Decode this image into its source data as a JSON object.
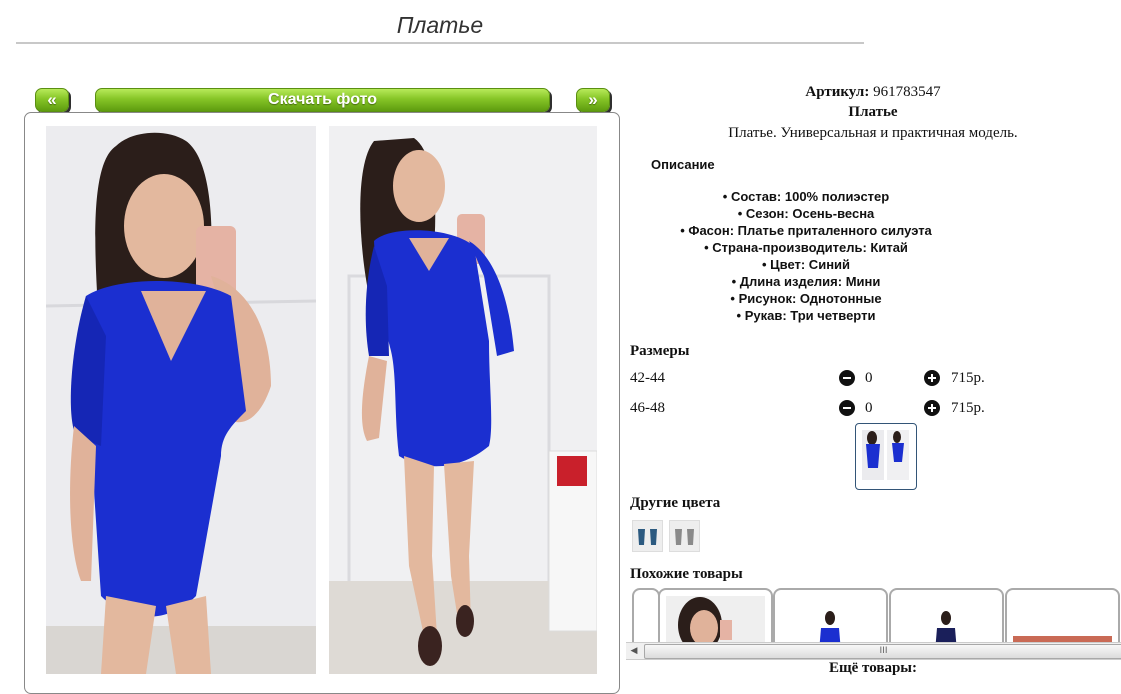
{
  "page": {
    "title": "Платье"
  },
  "nav": {
    "prev_label": "«",
    "download_label": "Скачать фото",
    "next_label": "»"
  },
  "product": {
    "article_label": "Артикул:",
    "article_value": "961783547",
    "name": "Платье",
    "short_description": "Платье. Универсальная и практичная модель."
  },
  "description": {
    "title": "Описание",
    "properties": [
      "Состав: 100% полиэстер",
      "Сезон: Осень-весна",
      "Фасон: Платье приталенного силуэта",
      "Страна-производитель: Китай",
      "Цвет: Синий",
      "Длина изделия: Мини",
      "Рисунок: Однотонные",
      "Рукав: Три четверти"
    ]
  },
  "sizes": {
    "title": "Размеры",
    "rows": [
      {
        "label": "42-44",
        "qty": "0",
        "price": "715р."
      },
      {
        "label": "46-48",
        "qty": "0",
        "price": "715р."
      }
    ]
  },
  "other_colors": {
    "title": "Другие цвета"
  },
  "similar": {
    "title": "Похожие товары"
  },
  "scrollbar": {
    "left_arrow": "◀",
    "grip": "III"
  },
  "more": {
    "label": "Ещё товары:"
  },
  "colors": {
    "accent_green": "#86c527",
    "dress_blue": "#1b2fd0"
  }
}
